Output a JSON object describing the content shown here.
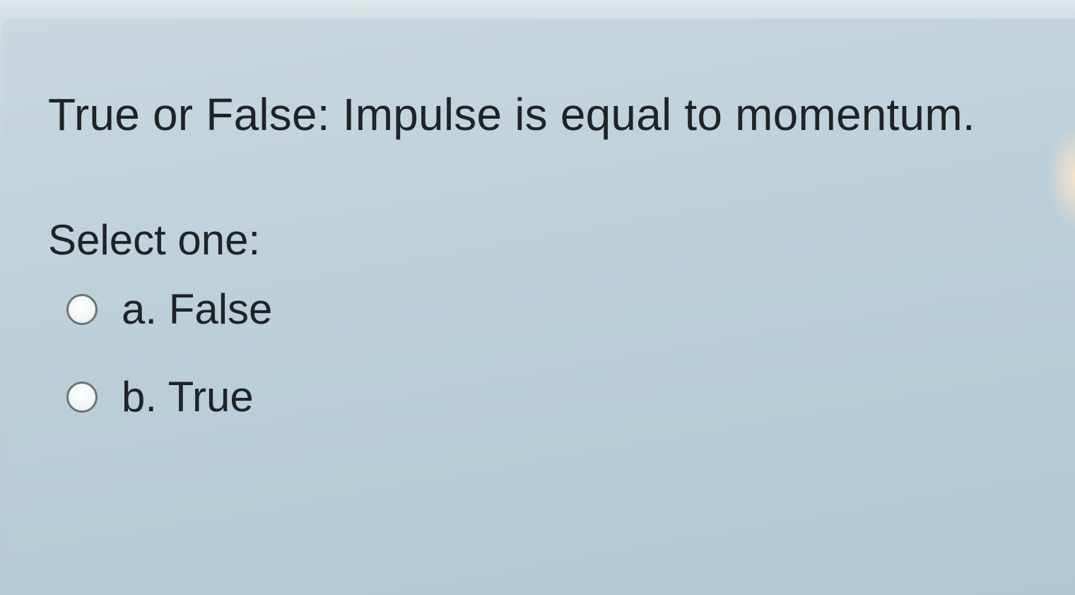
{
  "question": {
    "text": "True or False: Impulse is equal to momentum."
  },
  "answer": {
    "prompt": "Select one:",
    "options": [
      {
        "label": "a. False",
        "selected": false
      },
      {
        "label": "b. True",
        "selected": false
      }
    ]
  },
  "colors": {
    "text": "#1f2326",
    "panel_background": "#bccfd9",
    "radio_border": "#6d7478"
  }
}
